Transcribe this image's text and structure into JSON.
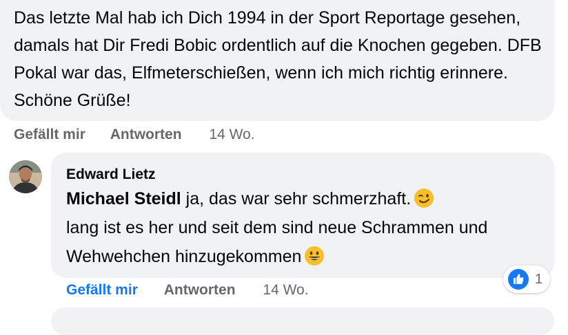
{
  "comment1": {
    "text": "Das letzte Mal hab ich Dich 1994 in der Sport Reportage gesehen, damals hat Dir Fredi Bobic ordentlich auf die Knochen gegeben. DFB Pokal war das, Elfmeterschießen, wenn ich mich richtig erinnere. Schöne Grüße!",
    "actions": {
      "like_label": "Gefällt mir",
      "reply_label": "Antworten",
      "time": "14 Wo."
    }
  },
  "reply1": {
    "author": "Edward Lietz",
    "mention": "Michael Steidl",
    "text_part1": " ja, das war sehr schmerzhaft.",
    "text_part2": "lang ist es her und seit dem sind neue Schrammen und Wehwehchen hinzugekommen",
    "emoji1": "winking-face-emoji",
    "emoji2": "grinning-face-emoji",
    "actions": {
      "like_label": "Gefällt mir",
      "reply_label": "Antworten",
      "time": "14 Wo."
    },
    "reactions": {
      "icon": "thumbs-up-icon",
      "count": "1"
    },
    "liked_color": "#1877f2"
  }
}
